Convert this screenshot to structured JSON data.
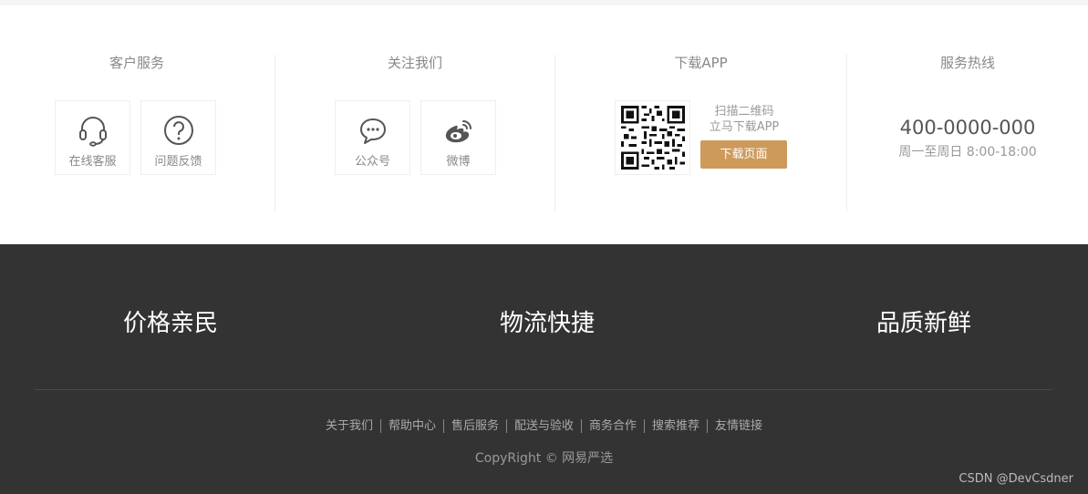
{
  "service": {
    "customer": {
      "title": "客户服务",
      "items": [
        {
          "label": "在线客服",
          "icon": "headset-icon"
        },
        {
          "label": "问题反馈",
          "icon": "question-circle-icon"
        }
      ]
    },
    "follow": {
      "title": "关注我们",
      "items": [
        {
          "label": "公众号",
          "icon": "chat-bubble-icon"
        },
        {
          "label": "微博",
          "icon": "weibo-icon"
        }
      ]
    },
    "app": {
      "title": "下载APP",
      "qr_icon": "qr-code-icon",
      "line1": "扫描二维码",
      "line2": "立马下载APP",
      "button": "下载页面",
      "button_color": "#cd9a5b"
    },
    "hotline": {
      "title": "服务热线",
      "number": "400-0000-000",
      "hours": "周一至周日 8:00-18:00"
    }
  },
  "footer": {
    "slogans": [
      "价格亲民",
      "物流快捷",
      "品质新鲜"
    ],
    "links": [
      "关于我们",
      "帮助中心",
      "售后服务",
      "配送与验收",
      "商务合作",
      "搜索推荐",
      "友情链接"
    ],
    "copyright": "CopyRight © 网易严选",
    "background": "#333333"
  },
  "watermark": "CSDN @DevCsdner"
}
